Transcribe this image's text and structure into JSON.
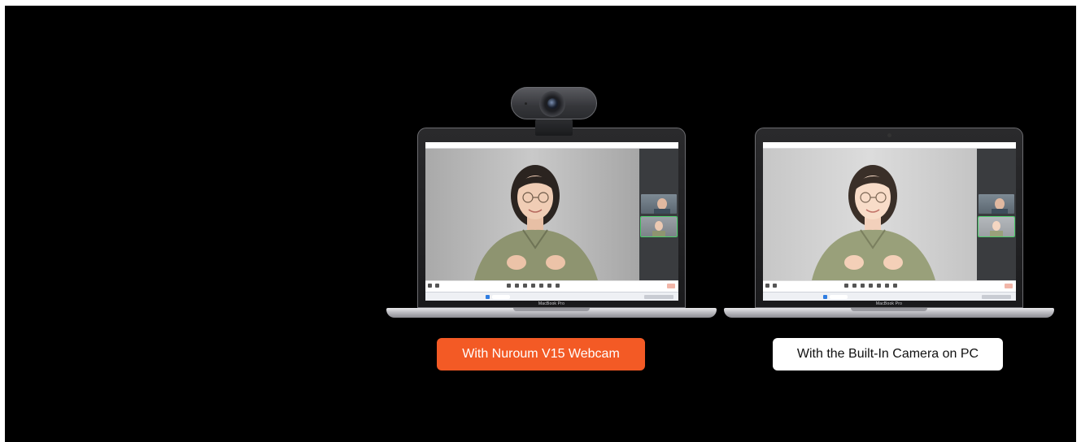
{
  "labels": {
    "with_webcam": "With Nuroum V15 Webcam",
    "with_builtin": "With the Built-In Camera on PC"
  },
  "laptop": {
    "model_label": "MacBook Pro"
  },
  "colors": {
    "accent_orange": "#f35a25",
    "background": "#000000",
    "label_white": "#ffffff"
  },
  "icons": {
    "webcam": "webcam-icon",
    "laptop": "laptop-icon"
  }
}
